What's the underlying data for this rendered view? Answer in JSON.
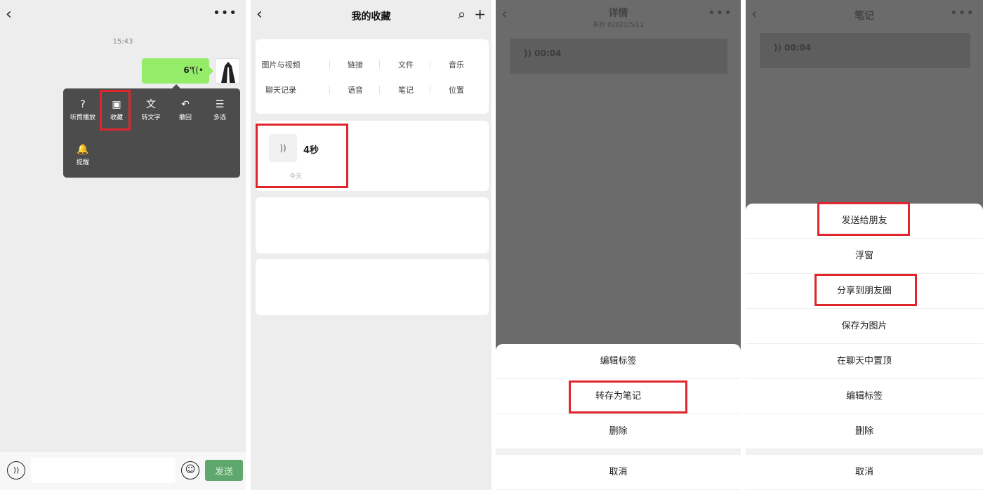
{
  "panel1": {
    "time": "15:43",
    "voice_message": {
      "duration": "6\""
    },
    "context_menu": [
      {
        "icon": "ear-icon",
        "label": "听筒播放"
      },
      {
        "icon": "box-icon",
        "label": "收藏"
      },
      {
        "icon": "text-icon",
        "label": "转文字"
      },
      {
        "icon": "undo-icon",
        "label": "撤回"
      },
      {
        "icon": "list-icon",
        "label": "多选"
      },
      {
        "icon": "bell-icon",
        "label": "提醒"
      }
    ],
    "send_label": "发送"
  },
  "panel2": {
    "title": "我的收藏",
    "categories": [
      "图片与视频",
      "链接",
      "文件",
      "音乐",
      "聊天记录",
      "语音",
      "笔记",
      "位置"
    ],
    "voice_item": {
      "label": "4秒",
      "date": "今天"
    }
  },
  "panel3": {
    "title": "详情",
    "subtitle": "来自      02021/5/11",
    "voice_duration": "00:04",
    "actions": [
      "编辑标签",
      "转存为笔记",
      "删除"
    ],
    "cancel": "取消"
  },
  "panel4": {
    "title": "笔记",
    "voice_duration": "00:04",
    "actions": [
      "发送给朋友",
      "浮窗",
      "分享到朋友圈",
      "保存为图片",
      "在聊天中置顶",
      "编辑标签",
      "删除"
    ],
    "cancel": "取消"
  },
  "colors": {
    "highlight": "#e0262c",
    "bubble": "#95ec69",
    "send": "#5ea86d"
  }
}
